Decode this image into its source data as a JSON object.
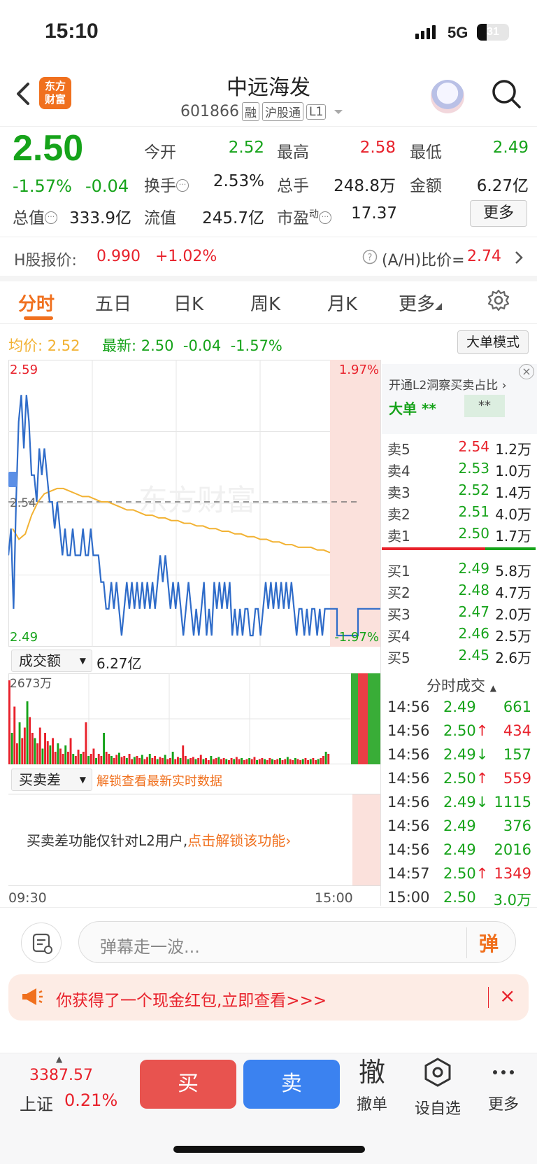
{
  "status": {
    "time": "15:10",
    "network": "5G",
    "battery": "31"
  },
  "header": {
    "logo": "东方财富",
    "name": "中远海发",
    "code": "601866",
    "tags": [
      "融",
      "沪股通",
      "L1"
    ]
  },
  "quote": {
    "price": "2.50",
    "pct": "-1.57%",
    "change": "-0.04",
    "open_label": "今开",
    "open": "2.52",
    "high_label": "最高",
    "high": "2.58",
    "low_label": "最低",
    "low": "2.49",
    "turnover_label": "换手",
    "turnover": "2.53%",
    "volume_label": "总手",
    "volume": "248.8万",
    "amount_label": "金额",
    "amount": "6.27亿",
    "mcap_label": "总值",
    "mcap": "333.9亿",
    "float_label": "流值",
    "float": "245.7亿",
    "pe_label": "市盈",
    "pe_sup": "动",
    "pe": "17.37",
    "more": "更多"
  },
  "hshare": {
    "label": "H股报价:",
    "price": "0.990",
    "pct": "+1.02%",
    "ratio_label": "(A/H)比价=",
    "ratio": "2.74"
  },
  "tabs": [
    "分时",
    "五日",
    "日K",
    "周K",
    "月K",
    "更多"
  ],
  "chart_info": {
    "avg_label": "均价:",
    "avg": "2.52",
    "latest_label": "最新:",
    "latest": "2.50",
    "chg": "-0.04",
    "pct": "-1.57%",
    "big_order": "大单模式",
    "watermark": "东方财富"
  },
  "chart_data": {
    "type": "line",
    "y_max": "2.59",
    "y_max_pct": "1.97%",
    "y_ref": "2.54",
    "y_min": "2.49",
    "y_min_pct": "-1.97%",
    "ylim": [
      2.49,
      2.59
    ],
    "ref_price": 2.54,
    "x_start": "09:30",
    "x_end": "15:00",
    "series": [
      {
        "name": "price",
        "color": "#2f6cc9",
        "values": [
          2.52,
          2.53,
          2.5,
          2.54,
          2.57,
          2.58,
          2.56,
          2.58,
          2.57,
          2.55,
          2.55,
          2.54,
          2.56,
          2.55,
          2.56,
          2.55,
          2.54,
          2.54,
          2.53,
          2.54,
          2.53,
          2.52,
          2.53,
          2.52,
          2.52,
          2.53,
          2.52,
          2.52,
          2.52,
          2.53,
          2.52,
          2.52,
          2.53,
          2.52,
          2.52,
          2.52,
          2.51,
          2.51,
          2.5,
          2.5,
          2.51,
          2.5,
          2.51,
          2.5,
          2.49,
          2.5,
          2.51,
          2.5,
          2.51,
          2.5,
          2.51,
          2.5,
          2.51,
          2.5,
          2.51,
          2.5,
          2.51,
          2.5,
          2.51,
          2.52,
          2.51,
          2.52,
          2.51,
          2.5,
          2.51,
          2.5,
          2.51,
          2.5,
          2.49,
          2.5,
          2.51,
          2.5,
          2.49,
          2.5,
          2.49,
          2.5,
          2.51,
          2.49,
          2.5,
          2.49,
          2.51,
          2.5,
          2.51,
          2.5,
          2.51,
          2.5,
          2.51,
          2.49,
          2.5,
          2.49,
          2.5,
          2.49,
          2.5,
          2.5,
          2.49,
          2.49,
          2.5,
          2.5,
          2.49,
          2.5,
          2.51,
          2.5,
          2.51,
          2.5,
          2.51,
          2.5,
          2.51,
          2.5,
          2.51,
          2.5,
          2.51,
          2.5,
          2.49,
          2.5,
          2.5,
          2.49,
          2.5,
          2.49,
          2.5,
          2.5,
          2.49,
          2.5,
          2.49,
          2.5,
          2.5,
          2.5
        ]
      },
      {
        "name": "average",
        "color": "#f2b233",
        "values": [
          2.53,
          2.526,
          2.528,
          2.535,
          2.54,
          2.543,
          2.544,
          2.545,
          2.545,
          2.544,
          2.543,
          2.542,
          2.542,
          2.541,
          2.54,
          2.54,
          2.539,
          2.538,
          2.537,
          2.537,
          2.536,
          2.535,
          2.535,
          2.534,
          2.534,
          2.533,
          2.533,
          2.532,
          2.532,
          2.531,
          2.531,
          2.53,
          2.53,
          2.529,
          2.529,
          2.528,
          2.528,
          2.527,
          2.527,
          2.526,
          2.526,
          2.525,
          2.525,
          2.524,
          2.524,
          2.523,
          2.523,
          2.523,
          2.522,
          2.522,
          2.521
        ]
      }
    ],
    "turnover_label": "成交额",
    "turnover_value": "6.27亿",
    "vol_max": "2673万",
    "volumes": [
      80,
      30,
      55,
      20,
      40,
      25,
      35,
      60,
      45,
      30,
      25,
      20,
      35,
      15,
      30,
      22,
      18,
      25,
      12,
      20,
      15,
      10,
      18,
      12,
      25,
      10,
      8,
      14,
      10,
      12,
      40,
      8,
      10,
      15,
      6,
      10,
      8,
      30,
      12,
      10,
      8,
      6,
      9,
      11,
      7,
      8,
      6,
      10,
      5,
      7,
      8,
      6,
      9,
      5,
      7,
      10,
      6,
      8,
      5,
      7,
      6,
      9,
      5,
      6,
      12,
      5,
      7,
      6,
      18,
      8,
      5,
      6,
      7,
      5,
      6,
      9,
      5,
      6,
      4,
      8,
      5,
      6,
      7,
      5,
      6,
      5,
      4,
      6,
      5,
      7,
      5,
      6,
      4,
      5,
      6,
      5,
      7,
      4,
      5,
      6,
      5,
      4,
      6,
      5,
      4,
      5,
      6,
      4,
      5,
      7,
      5,
      4,
      6,
      5,
      4,
      5,
      6,
      4,
      5,
      6,
      4,
      5,
      6,
      8,
      12,
      10
    ]
  },
  "spread": {
    "label": "买卖差",
    "unlock": "解锁查看最新实时数据",
    "note": "买卖差功能仅针对L2用户,",
    "note_link": "点击解锁该功能"
  },
  "orderbook": {
    "promo": "开通L2洞察买卖占比",
    "big_label": "大单",
    "big_stars": "**",
    "big_stars2": "**",
    "asks": [
      {
        "l": "卖5",
        "p": "2.54",
        "v": "1.2万",
        "c": "red"
      },
      {
        "l": "卖4",
        "p": "2.53",
        "v": "1.0万",
        "c": "green"
      },
      {
        "l": "卖3",
        "p": "2.52",
        "v": "1.4万",
        "c": "green"
      },
      {
        "l": "卖2",
        "p": "2.51",
        "v": "4.0万",
        "c": "green"
      },
      {
        "l": "卖1",
        "p": "2.50",
        "v": "1.7万",
        "c": "green"
      }
    ],
    "bids": [
      {
        "l": "买1",
        "p": "2.49",
        "v": "5.8万",
        "c": "green"
      },
      {
        "l": "买2",
        "p": "2.48",
        "v": "4.7万",
        "c": "green"
      },
      {
        "l": "买3",
        "p": "2.47",
        "v": "2.0万",
        "c": "green"
      },
      {
        "l": "买4",
        "p": "2.46",
        "v": "2.5万",
        "c": "green"
      },
      {
        "l": "买5",
        "p": "2.45",
        "v": "2.6万",
        "c": "green"
      }
    ],
    "ticks_title": "分时成交",
    "ticks": [
      {
        "t": "14:56",
        "p": "2.49",
        "a": "",
        "v": "661",
        "vc": "green"
      },
      {
        "t": "14:56",
        "p": "2.50",
        "a": "↑",
        "v": "434",
        "vc": "red"
      },
      {
        "t": "14:56",
        "p": "2.49",
        "a": "↓",
        "v": "157",
        "vc": "green"
      },
      {
        "t": "14:56",
        "p": "2.50",
        "a": "↑",
        "v": "559",
        "vc": "red"
      },
      {
        "t": "14:56",
        "p": "2.49",
        "a": "↓",
        "v": "1115",
        "vc": "green"
      },
      {
        "t": "14:56",
        "p": "2.49",
        "a": "",
        "v": "376",
        "vc": "green"
      },
      {
        "t": "14:56",
        "p": "2.49",
        "a": "",
        "v": "2016",
        "vc": "green"
      },
      {
        "t": "14:57",
        "p": "2.50",
        "a": "↑",
        "v": "1349",
        "vc": "red"
      },
      {
        "t": "15:00",
        "p": "2.50",
        "a": "",
        "v": "3.0万",
        "vc": "green"
      }
    ]
  },
  "danmu": {
    "placeholder": "弹幕走一波...",
    "btn": "弹"
  },
  "banner": {
    "text": "你获得了一个现金红包,立即查看>>>"
  },
  "nav": {
    "index_value": "3387.57",
    "index_name": "上证",
    "index_pct": "0.21%",
    "buy": "买",
    "sell": "卖",
    "cancel_icon": "撤",
    "cancel": "撤单",
    "watch": "设自选",
    "more": "更多"
  }
}
